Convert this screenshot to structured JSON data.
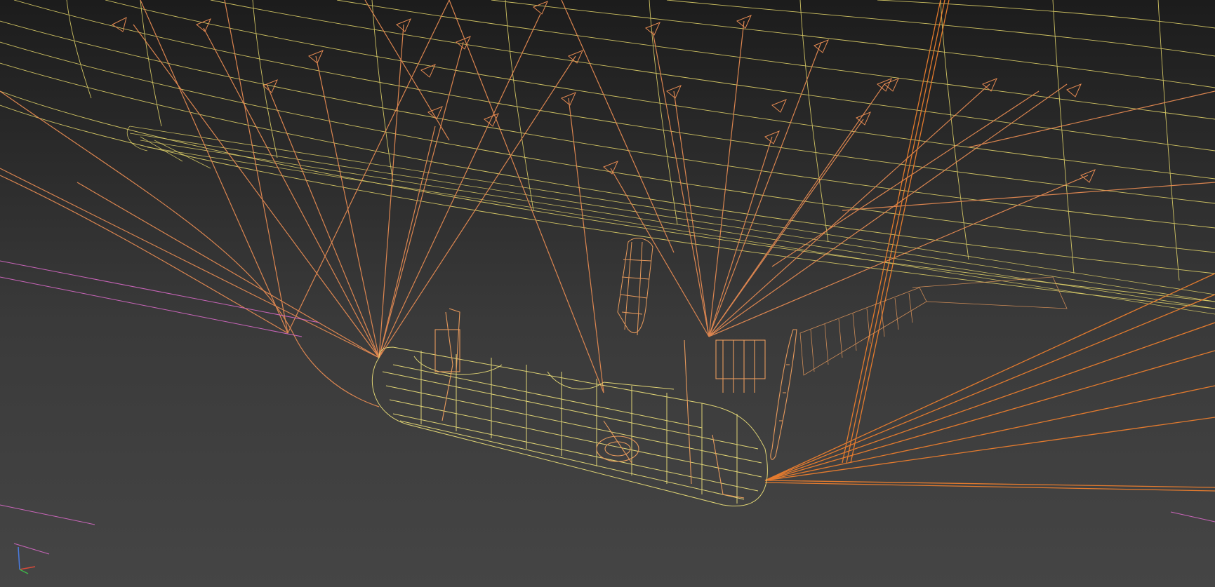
{
  "viewport": {
    "render_mode": "wireframe",
    "background_top": "#1c1c1c",
    "background_bottom": "#454545"
  },
  "colors": {
    "envelope_wire": "#e2d46a",
    "rigging_wire": "#e58a52",
    "gondola_wire": "#e8dc78",
    "gondola_detail": "#e89a5c",
    "bright_rigging": "#ee7f2e",
    "guide_lines": "#d96ac8",
    "axis_x": "#d94a3a",
    "axis_y": "#3fb54a",
    "axis_z": "#4a7be0"
  },
  "objects": [
    {
      "name": "airship-envelope",
      "kind": "wireframe mesh"
    },
    {
      "name": "suspension-rigging",
      "kind": "wireframe lines"
    },
    {
      "name": "gondola",
      "kind": "wireframe mesh"
    },
    {
      "name": "propeller",
      "kind": "wireframe mesh"
    },
    {
      "name": "rudder-fin",
      "kind": "wireframe mesh"
    },
    {
      "name": "hanging-tank",
      "kind": "wireframe mesh"
    }
  ],
  "gizmo": {
    "icons": [
      "axis-x-icon",
      "axis-y-icon",
      "axis-z-icon"
    ]
  }
}
